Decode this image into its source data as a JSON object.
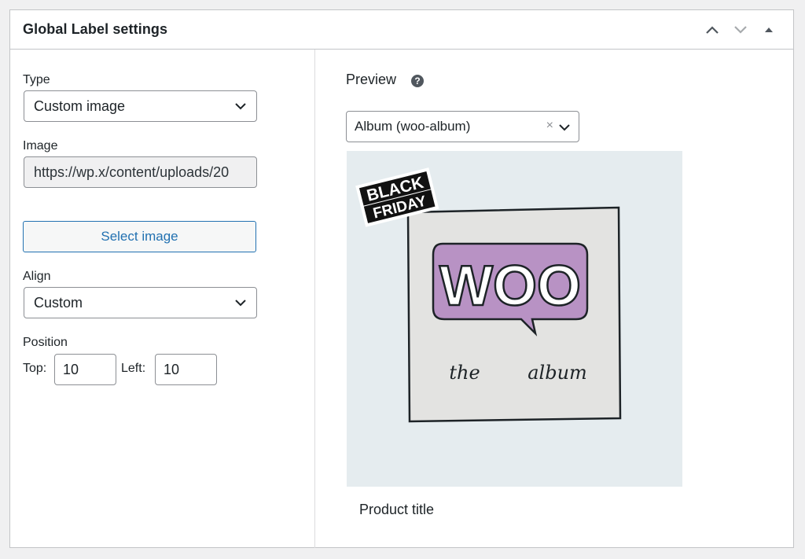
{
  "panel": {
    "title": "Global Label settings"
  },
  "settings": {
    "type_label": "Type",
    "type_value": "Custom image",
    "image_label": "Image",
    "image_url": "https://wp.x/content/uploads/20",
    "select_image_label": "Select image",
    "align_label": "Align",
    "align_value": "Custom",
    "position_label": "Position",
    "top_label": "Top:",
    "top_value": "10",
    "left_label": "Left:",
    "left_value": "10"
  },
  "preview": {
    "title": "Preview",
    "help": "?",
    "product_select": "Album (woo-album)",
    "clear": "×",
    "product_title": "Product title",
    "label_badge": {
      "line1": "BLACK",
      "line2": "FRIDAY"
    },
    "album_art": {
      "logo": "WOO",
      "subtitle_left": "the",
      "subtitle_right": "album"
    }
  },
  "colors": {
    "accent": "#2271b1",
    "woo_purple": "#b892c4",
    "preview_bg": "#e5ecef"
  }
}
